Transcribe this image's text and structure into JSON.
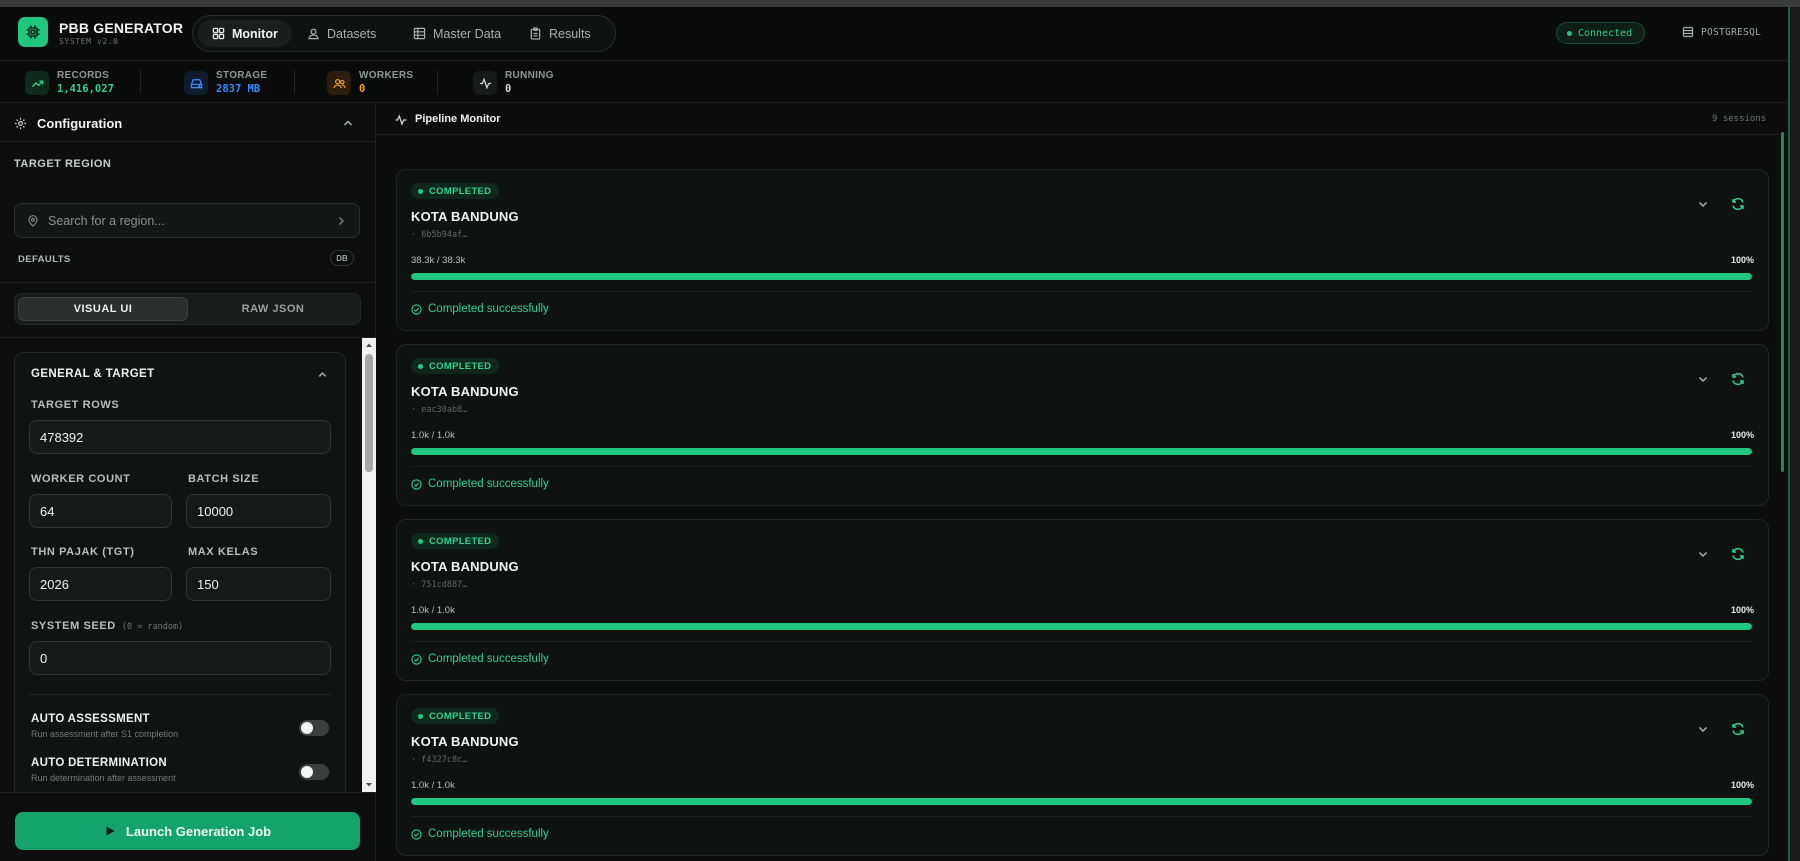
{
  "app": {
    "title": "PBB GENERATOR",
    "subtitle": "SYSTEM v2.0"
  },
  "nav": [
    {
      "label": "Monitor",
      "icon": "grid-icon",
      "active": true
    },
    {
      "label": "Datasets",
      "icon": "users-icon",
      "active": false
    },
    {
      "label": "Master Data",
      "icon": "table-icon",
      "active": false
    },
    {
      "label": "Results",
      "icon": "clipboard-icon",
      "active": false
    }
  ],
  "status": {
    "connection": "Connected",
    "database": "POSTGRESQL"
  },
  "stats": [
    {
      "label": "RECORDS",
      "value": "1,416,027",
      "color": "#2fd08a",
      "icon": "trending-up-icon"
    },
    {
      "label": "STORAGE",
      "value": "2837 MB",
      "color": "#3b8cff",
      "icon": "hard-drive-icon"
    },
    {
      "label": "WORKERS",
      "value": "0",
      "color": "#f59e2a",
      "icon": "users-icon"
    },
    {
      "label": "RUNNING",
      "value": "0",
      "color": "#cfd4d2",
      "icon": "activity-icon"
    }
  ],
  "config": {
    "title": "Configuration",
    "target_region_label": "TARGET REGION",
    "search_placeholder": "Search for a region...",
    "defaults_label": "DEFAULTS",
    "db_badge": "DB",
    "view_toggle": {
      "visual": "VISUAL UI",
      "raw": "RAW JSON",
      "active": "visual"
    },
    "section_title": "GENERAL & TARGET",
    "fields": {
      "target_rows": {
        "label": "TARGET ROWS",
        "value": "478392"
      },
      "worker_count": {
        "label": "WORKER COUNT",
        "value": "64"
      },
      "batch_size": {
        "label": "BATCH SIZE",
        "value": "10000"
      },
      "thn_pajak": {
        "label": "THN PAJAK (TGT)",
        "value": "2026"
      },
      "max_kelas": {
        "label": "MAX KELAS",
        "value": "150"
      },
      "system_seed": {
        "label": "SYSTEM SEED",
        "hint": "(0 = random)",
        "value": "0"
      }
    },
    "toggles": [
      {
        "title": "AUTO ASSESSMENT",
        "desc": "Run assessment after S1 completion",
        "on": false
      },
      {
        "title": "AUTO DETERMINATION",
        "desc": "Run determination after assessment",
        "on": false
      }
    ],
    "launch_label": "Launch Generation Job"
  },
  "monitor": {
    "title": "Pipeline Monitor",
    "sessions": "9 sessions",
    "jobs": [
      {
        "status": "COMPLETED",
        "name": "KOTA BANDUNG",
        "hash": "· 6b5b94af…",
        "count": "38.3k / 38.3k",
        "percent": "100%",
        "progress": 1.0,
        "message": "Completed successfully"
      },
      {
        "status": "COMPLETED",
        "name": "KOTA BANDUNG",
        "hash": "· eac30ab8…",
        "count": "1.0k / 1.0k",
        "percent": "100%",
        "progress": 1.0,
        "message": "Completed successfully"
      },
      {
        "status": "COMPLETED",
        "name": "KOTA BANDUNG",
        "hash": "· 751cd887…",
        "count": "1.0k / 1.0k",
        "percent": "100%",
        "progress": 1.0,
        "message": "Completed successfully"
      },
      {
        "status": "COMPLETED",
        "name": "KOTA BANDUNG",
        "hash": "· f4327c8c…",
        "count": "1.0k / 1.0k",
        "percent": "100%",
        "progress": 1.0,
        "message": "Completed successfully"
      }
    ]
  }
}
